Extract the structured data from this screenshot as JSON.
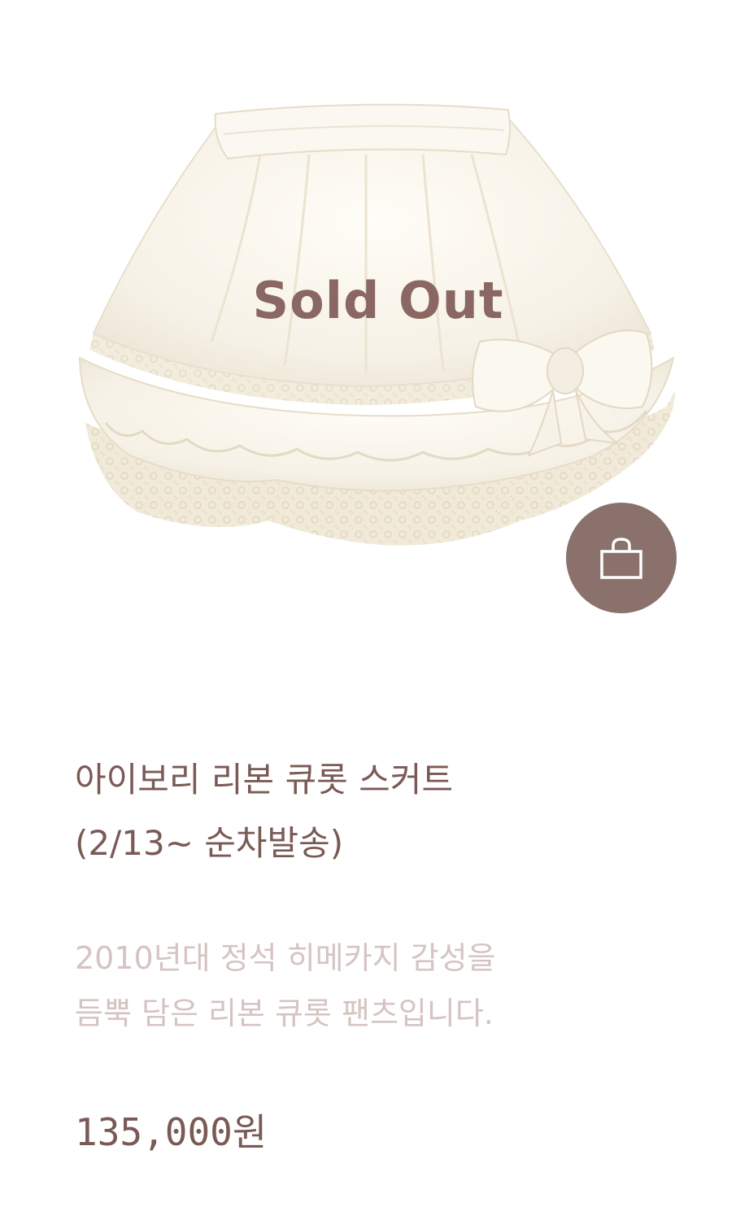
{
  "product": {
    "sold_out_label": "Sold Out",
    "title_line1": "아이보리 리본 큐롯 스커트",
    "title_line2": "(2/13~ 순차발송)",
    "desc_line1": "2010년대 정석 히메카지 감성을",
    "desc_line2": "듬뿍 담은 리본 큐롯 팬츠입니다.",
    "price": "135,000원",
    "image_alt": "ivory ribbon culotte skirt"
  },
  "icons": {
    "cart": "shopping-bag-icon"
  },
  "colors": {
    "accent": "#8a716b",
    "title_text": "#7a5a55",
    "desc_text": "#d5c4c2",
    "sold_out_text": "#8a6762"
  }
}
